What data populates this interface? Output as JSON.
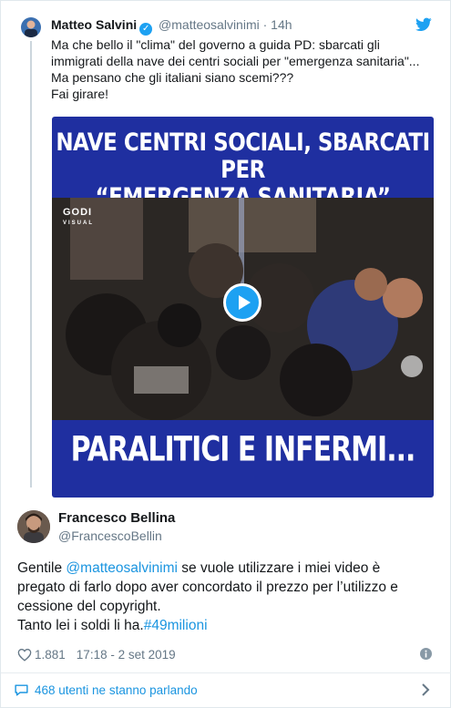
{
  "quoted_tweet": {
    "name": "Matteo Salvini",
    "handle": "@matteosalvinimi",
    "separator": "·",
    "time": "14h",
    "lines": [
      "Ma che bello il \"clima\" del governo a guida PD: sbarcati gli",
      "immigrati della nave dei centri sociali per \"emergenza sanitaria\"...",
      "Ma pensano che gli italiani siano scemi???",
      "Fai girare!"
    ],
    "video": {
      "top_line1": "NAVE CENTRI SOCIALI, SBARCATI PER",
      "top_line2": "“EMERGENZA SANITARIA”",
      "bottom_text": "PARALITICI E INFERMI...",
      "logo_line1": "GODI",
      "logo_line2": "VISUAL"
    }
  },
  "tweet": {
    "name": "Francesco Bellina",
    "handle": "@FrancescoBellin",
    "text_prefix": "Gentile ",
    "mention": "@matteosalvinimi",
    "text_line1_rest": " se vuole utilizzare i miei video è",
    "text_line2": "pregato di farlo dopo aver concordato il prezzo per l’utilizzo e",
    "text_line3": "cessione del copyright.",
    "text_line4_prefix": "Tanto lei i soldi li ha.",
    "hashtag": "#49milioni",
    "likes": "1.881",
    "timestamp": "17:18 - 2 set 2019"
  },
  "footer": {
    "label": "468 utenti ne stanno parlando"
  },
  "colors": {
    "link": "#1b95e0",
    "twitter_blue": "#1da1f2",
    "video_blue": "#1f2fa0",
    "muted": "#657786"
  }
}
